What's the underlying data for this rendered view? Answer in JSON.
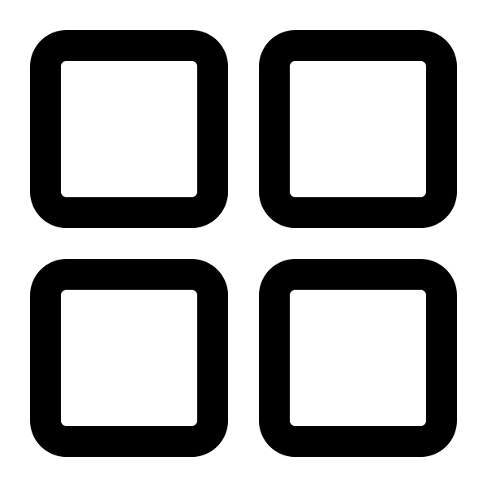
{
  "icon": {
    "name": "grid-icon",
    "tile_count": 4,
    "stroke_color": "#000000",
    "fill_color": "#ffffff",
    "background_color": "#ffffff"
  }
}
